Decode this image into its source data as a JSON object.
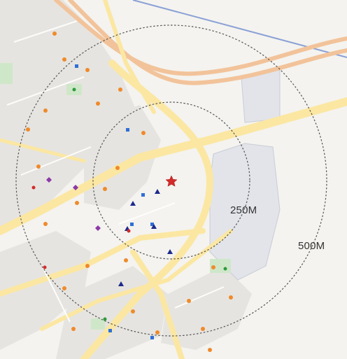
{
  "map": {
    "center_marker": {
      "icon": "star-icon",
      "color": "#d42a2a"
    },
    "radius_labels": [
      "250M",
      "500M"
    ],
    "ring_color": "#555555",
    "marker_legend": [
      {
        "icon": "orange-dot-icon",
        "color": "#ef8a2b"
      },
      {
        "icon": "blue-square-icon",
        "color": "#2f6fd6"
      },
      {
        "icon": "navy-triangle-icon",
        "color": "#1d2a8a"
      },
      {
        "icon": "purple-diamond-icon",
        "color": "#8b3aa8"
      },
      {
        "icon": "red-dot-icon",
        "color": "#d42a2a"
      },
      {
        "icon": "green-dot-icon",
        "color": "#2e9a3e"
      }
    ],
    "colors": {
      "background": "#f4f3ef",
      "road": "#fbeaa9",
      "expressway": "#f5c9a6",
      "water_line": "#8aa0d6",
      "block": "#e7e5e1",
      "park": "#cfe7c9"
    }
  }
}
